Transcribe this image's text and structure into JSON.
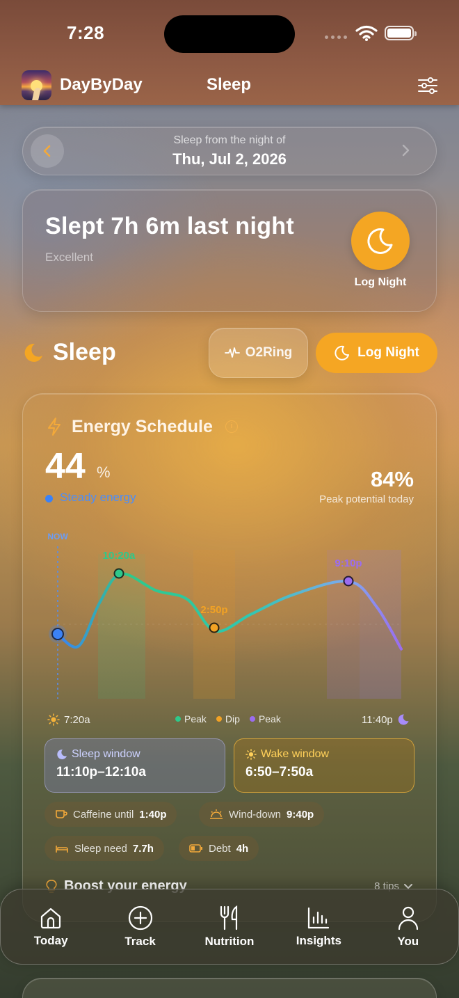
{
  "status_bar": {
    "time": "7:28"
  },
  "header": {
    "app_name": "DayByDay",
    "title": "Sleep",
    "icons": [
      "app-logo",
      "sliders-icon"
    ]
  },
  "date_picker": {
    "caption": "Sleep from the night of",
    "date": "Thu, Jul 2, 2026"
  },
  "summary": {
    "title": "Slept 7h 6m last night",
    "quality": "Excellent",
    "action_label": "Log Night"
  },
  "section": {
    "title": "Sleep",
    "o2_label": "O2Ring",
    "log_label": "Log Night"
  },
  "energy": {
    "title": "Energy Schedule",
    "value": "44",
    "unit": "%",
    "state": "Steady energy",
    "peak_value": "84%",
    "peak_label": "Peak potential today",
    "now_label": "NOW",
    "start_time": "7:20a",
    "end_time": "11:40p",
    "legend": [
      {
        "label": "Peak",
        "color": "#2fc88a"
      },
      {
        "label": "Dip",
        "color": "#f2a224"
      },
      {
        "label": "Peak",
        "color": "#9b6cf0"
      }
    ],
    "sleep_window": {
      "label": "Sleep window",
      "value": "11:10p–12:10a"
    },
    "wake_window": {
      "label": "Wake window",
      "value": "6:50–7:50a"
    },
    "chips": {
      "caffeine": {
        "label": "Caffeine until",
        "value": "1:40p"
      },
      "winddown": {
        "label": "Wind-down",
        "value": "9:40p"
      },
      "need": {
        "label": "Sleep need",
        "value": "7.7h"
      },
      "debt": {
        "label": "Debt",
        "value": "4h"
      }
    },
    "boost": {
      "title": "Boost your energy",
      "tips": "8 tips"
    }
  },
  "chart_data": {
    "type": "line",
    "title": "Energy Schedule",
    "xlabel": "",
    "ylabel": "",
    "x_range": [
      "7:20a",
      "11:40p"
    ],
    "series": [
      {
        "values": [
          {
            "x": "7:20a",
            "y": 44
          },
          {
            "x": "8:20a",
            "y": 36
          },
          {
            "x": "9:20a",
            "y": 65
          },
          {
            "x": "10:20a",
            "y": 84
          },
          {
            "x": "12:00p",
            "y": 73
          },
          {
            "x": "1:30p",
            "y": 67
          },
          {
            "x": "2:50p",
            "y": 46
          },
          {
            "x": "4:30p",
            "y": 57
          },
          {
            "x": "6:30p",
            "y": 70
          },
          {
            "x": "9:10p",
            "y": 79
          },
          {
            "x": "10:30p",
            "y": 62
          },
          {
            "x": "11:40p",
            "y": 34
          }
        ]
      }
    ],
    "markers": [
      {
        "label": "10:20a",
        "kind": "Peak",
        "color": "#2fc88a"
      },
      {
        "label": "2:50p",
        "kind": "Dip",
        "color": "#f2a224"
      },
      {
        "label": "9:10p",
        "kind": "Peak",
        "color": "#9b6cf0"
      }
    ],
    "grid": false,
    "legend": "bottom-center"
  },
  "tabs": [
    {
      "label": "Today",
      "icon": "home-icon"
    },
    {
      "label": "Track",
      "icon": "plus-circle-icon"
    },
    {
      "label": "Nutrition",
      "icon": "fork-knife-icon"
    },
    {
      "label": "Insights",
      "icon": "bar-chart-icon"
    },
    {
      "label": "You",
      "icon": "person-icon"
    }
  ]
}
